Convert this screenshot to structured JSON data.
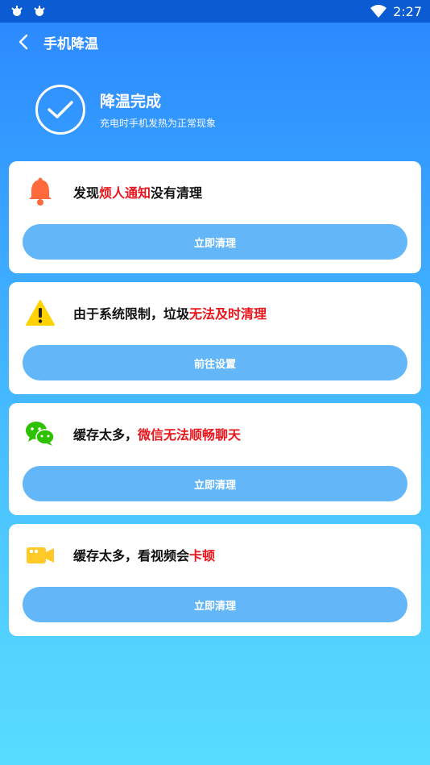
{
  "status_bar": {
    "time": "2:27"
  },
  "appbar": {
    "title": "手机降温"
  },
  "hero": {
    "title": "降温完成",
    "subtitle": "充电时手机发热为正常现象"
  },
  "cards": [
    {
      "icon": "bell-icon",
      "text_pre": "发现",
      "text_highlight": "烦人通知",
      "text_post": "没有清理",
      "button": "立即清理"
    },
    {
      "icon": "warning-icon",
      "text_pre": "由于系统限制，垃圾",
      "text_highlight": "无法及时清理",
      "text_post": "",
      "button": "前往设置"
    },
    {
      "icon": "wechat-icon",
      "text_pre": "缓存太多，",
      "text_highlight": "微信无法顺畅聊天",
      "text_post": "",
      "button": "立即清理"
    },
    {
      "icon": "video-camera-icon",
      "text_pre": "缓存太多，看视频会",
      "text_highlight": "卡顿",
      "text_post": "",
      "button": "立即清理"
    }
  ],
  "colors": {
    "accent": "#2a86ff",
    "button": "#63b6f8",
    "highlight": "#e8161c"
  }
}
